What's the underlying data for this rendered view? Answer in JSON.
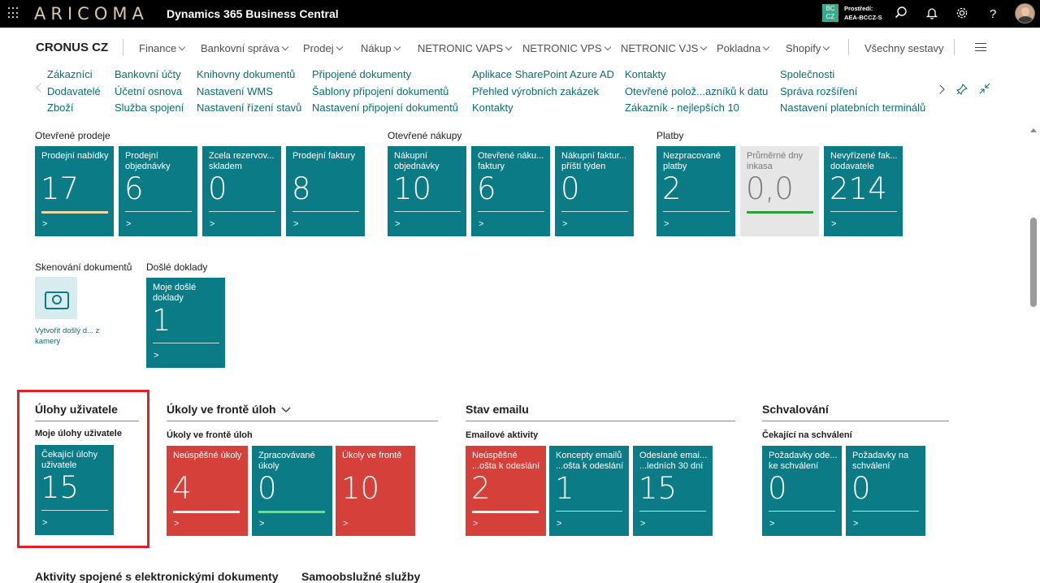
{
  "topbar": {
    "brand": "ARICOMA",
    "product": "Dynamics 365 Business Central",
    "env_badge_line1": "BC",
    "env_badge_line2": "CZ",
    "env_label": "Prostředí:",
    "env_name": "AEA-BCCZ-S",
    "icons": [
      "waffle-icon",
      "search-icon",
      "bell-icon",
      "gear-icon",
      "help-icon",
      "avatar"
    ]
  },
  "nav": {
    "company": "CRONUS CZ",
    "menus": [
      "Finance",
      "Bankovní správa",
      "Prodej",
      "Nákup",
      "NETRONIC VAPS",
      "NETRONIC VPS",
      "NETRONIC VJS",
      "Pokladna",
      "Shopify"
    ],
    "all_reports": "Všechny sestavy"
  },
  "links": {
    "col1": [
      "Zákazníci",
      "Dodavatelé",
      "Zboží"
    ],
    "col2": [
      "Bankovní účty",
      "Účetní osnova",
      "Služba spojení"
    ],
    "col3": [
      "Knihovny dokumentů",
      "Nastavení WMS",
      "Nastavení řízení stavů"
    ],
    "col4": [
      "Připojené dokumenty",
      "Šablony připojení dokumentů",
      "Nastavení připojení dokumentů"
    ],
    "col5": [
      "Aplikace SharePoint Azure AD",
      "Přehled výrobních zakázek",
      "Kontakty"
    ],
    "col6": [
      "Kontakty",
      "Otevřené polož...azníků k datu",
      "Zákazník - nejlepších 10"
    ],
    "col7": [
      "Společnosti",
      "Správa rozšíření",
      "Nastavení platebních terminálů"
    ]
  },
  "groups": {
    "open_sales": {
      "title": "Otevřené prodeje",
      "tiles": [
        {
          "title": "Prodejní nabídky",
          "value": "17"
        },
        {
          "title": "Prodejní objednávky",
          "value": "6"
        },
        {
          "title": "Zcela rezervov... skladem",
          "value": "0"
        },
        {
          "title": "Prodejní faktury",
          "value": "8"
        }
      ]
    },
    "open_purchases": {
      "title": "Otevřené nákupy",
      "tiles": [
        {
          "title": "Nákupní objednávky",
          "value": "10"
        },
        {
          "title": "Otevřené náku... faktury",
          "value": "6"
        },
        {
          "title": "Nákupní faktur... příští týden",
          "value": "0"
        }
      ]
    },
    "payments": {
      "title": "Platby",
      "tiles": [
        {
          "title": "Nezpracované platby",
          "value": "2"
        },
        {
          "title": "Průměrné dny inkasa",
          "value": "0,0"
        },
        {
          "title": "Nevyřízené fak... dodavatele",
          "value": "214"
        }
      ]
    },
    "scan": {
      "title": "Skenování dokumentů",
      "link": "Vytvořit došlý d... z kamery"
    },
    "incoming": {
      "title": "Došlé doklady",
      "tiles": [
        {
          "title": "Moje došlé doklady",
          "value": "1"
        }
      ]
    }
  },
  "parts": {
    "user_tasks": {
      "header": "Úlohy uživatele",
      "subgroup": "Moje úlohy uživatele",
      "tiles": [
        {
          "title": "Čekající úlohy uživatele",
          "value": "15"
        }
      ]
    },
    "job_queue": {
      "header": "Úkoly ve frontě úloh",
      "subgroup": "Úkoly ve frontě úloh",
      "tiles": [
        {
          "title": "Neúspěšné úkoly",
          "value": "4"
        },
        {
          "title": "Zpracovávané úkoly",
          "value": "0"
        },
        {
          "title": "Úkoly ve frontě",
          "value": "10"
        }
      ]
    },
    "email": {
      "header": "Stav emailu",
      "subgroup": "Emailové aktivity",
      "tiles": [
        {
          "title": "Neúspěšné ...ošta k odeslání",
          "value": "2"
        },
        {
          "title": "Koncepty emailů ...ošta k odeslání",
          "value": "1"
        },
        {
          "title": "Odeslané emai... ...ledních 30 dní",
          "value": "15"
        }
      ]
    },
    "approvals": {
      "header": "Schvalování",
      "subgroup": "Čekající na schválení",
      "tiles": [
        {
          "title": "Požadavky ode... ke schválení",
          "value": "0"
        },
        {
          "title": "Požadavky na schválení",
          "value": "0"
        }
      ]
    }
  },
  "bottom": {
    "edocs": "Aktivity spojené s elektronickými dokumenty",
    "selfservice": "Samoobslužné služby"
  },
  "go_symbol": ">",
  "colors": {
    "tile_teal": "#0b7b85",
    "tile_red": "#d6403a",
    "tile_grey": "#e6e6e6",
    "bar_yellow": "#e8d9a6",
    "bar_green_dark": "#2e9e3a",
    "bar_green_light": "#6fe36a",
    "highlight_red": "#e0202a"
  }
}
